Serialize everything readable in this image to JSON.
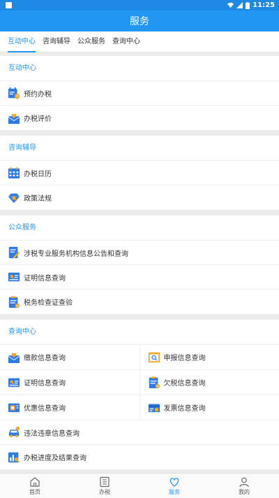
{
  "status_bar": {
    "time": "11:25"
  },
  "app_bar": {
    "title": "服务"
  },
  "tabs": [
    {
      "label": "互动中心",
      "active": true
    },
    {
      "label": "咨询辅导",
      "active": false
    },
    {
      "label": "公众服务",
      "active": false
    },
    {
      "label": "查询中心",
      "active": false
    }
  ],
  "sections": {
    "interaction": {
      "title": "互动中心",
      "items": [
        {
          "label": "预约办税",
          "icon": "calendar-clock-icon"
        },
        {
          "label": "办税评价",
          "icon": "envelope-heart-icon"
        }
      ]
    },
    "consulting": {
      "title": "咨询辅导",
      "items": [
        {
          "label": "办税日历",
          "icon": "calendar-icon"
        },
        {
          "label": "政策法规",
          "icon": "diamond-search-icon"
        }
      ]
    },
    "public": {
      "title": "公众服务",
      "items": [
        {
          "label": "涉税专业服务机构信息公告和查询",
          "icon": "document-pen-icon"
        },
        {
          "label": "证明信息查询",
          "icon": "id-card-icon"
        },
        {
          "label": "税务检查证查验",
          "icon": "document-list-icon"
        }
      ]
    },
    "query": {
      "title": "查询中心",
      "grid": [
        [
          {
            "label": "缴款信息查询",
            "icon": "envelope-heart-icon"
          },
          {
            "label": "申报信息查询",
            "icon": "card-search-icon"
          }
        ],
        [
          {
            "label": "证明信息查询",
            "icon": "id-card-icon"
          },
          {
            "label": "欠税信息查询",
            "icon": "document-list-icon"
          }
        ],
        [
          {
            "label": "优惠信息查询",
            "icon": "coupon-icon"
          },
          {
            "label": "发票信息查询",
            "icon": "invoice-card-icon"
          }
        ]
      ],
      "items": [
        {
          "label": "违法违章信息查询",
          "icon": "car-icon"
        },
        {
          "label": "办税进度及结果查询",
          "icon": "chart-search-icon"
        }
      ]
    }
  },
  "bottom_nav": [
    {
      "label": "首页",
      "icon": "home-icon",
      "active": false
    },
    {
      "label": "办税",
      "icon": "list-icon",
      "active": false
    },
    {
      "label": "服务",
      "icon": "heart-icon",
      "active": true
    },
    {
      "label": "我的",
      "icon": "user-icon",
      "active": false
    }
  ],
  "colors": {
    "primary": "#2196f3",
    "status_bar": "#1e88e5",
    "icon_orange": "#f5a623",
    "background": "#ececec"
  }
}
